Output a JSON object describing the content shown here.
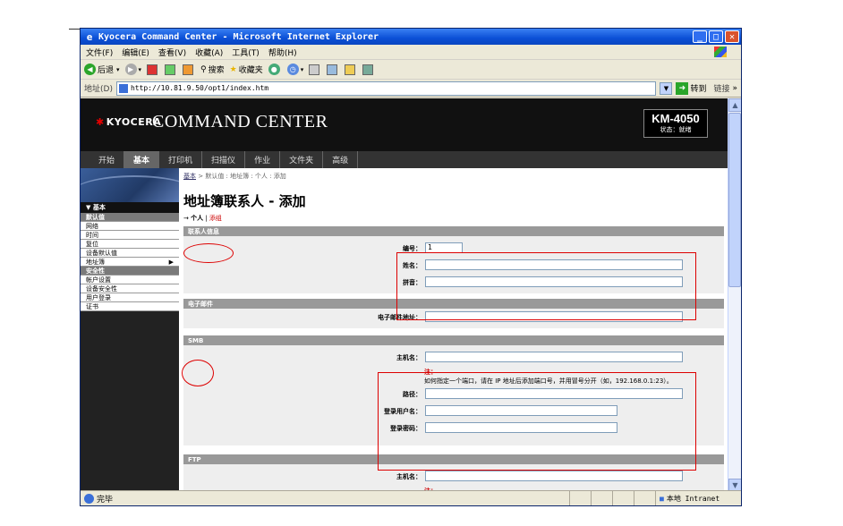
{
  "window": {
    "title": "Kyocera Command Center - Microsoft Internet Explorer",
    "minimize": "_",
    "maximize": "□",
    "close": "✕"
  },
  "menu": [
    "文件(F)",
    "编辑(E)",
    "查看(V)",
    "收藏(A)",
    "工具(T)",
    "帮助(H)"
  ],
  "toolbar": {
    "back": "后退",
    "search": "搜索",
    "favorites": "收藏夹"
  },
  "address": {
    "label": "地址(D)",
    "url": "http://10.81.9.50/opt1/index.htm",
    "go": "转到",
    "links": "链接"
  },
  "header": {
    "brand": "KYOCERA",
    "app_title": "COMMAND CENTER",
    "model": "KM-4050",
    "status": "状态：就绪"
  },
  "nav": {
    "tabs": [
      "开始",
      "基本",
      "打印机",
      "扫描仪",
      "作业",
      "文件夹",
      "高级"
    ],
    "active_index": 1
  },
  "sidebar": {
    "group1_head": "▼ 基本",
    "items": [
      {
        "label": "默认值",
        "selected": true
      },
      {
        "label": "网络",
        "selected": false
      },
      {
        "label": "时间",
        "selected": false
      },
      {
        "label": "复位",
        "selected": false
      },
      {
        "label": "设备默认值",
        "selected": false
      },
      {
        "label": "地址簿",
        "selected": false,
        "chevron": "▶"
      },
      {
        "label": "安全性",
        "selected": true
      },
      {
        "label": "帐户设置",
        "selected": false
      },
      {
        "label": "设备安全性",
        "selected": false
      },
      {
        "label": "用户登录",
        "selected": false
      },
      {
        "label": "证书",
        "selected": false
      }
    ]
  },
  "content": {
    "breadcrumb_link": "基本",
    "breadcrumb_rest": " > 默认值 : 地址簿 : 个人 : 添加",
    "page_title": "地址簿联系人 - 添加",
    "subnav_prefix": "→ ",
    "subnav_current": "个人",
    "subnav_sep": " | ",
    "subnav_link": "添组",
    "sections": {
      "contact": {
        "title": "联系人信息",
        "number_label": "编号：",
        "number_value": "1",
        "name_label": "姓名：",
        "furigana_label": "拼音："
      },
      "email": {
        "title": "电子邮件",
        "address_label": "电子邮件地址："
      },
      "smb": {
        "title": "SMB",
        "host_label": "主机名：",
        "note_head": "注：",
        "note_text": "如何指定一个端口，请在 IP 地址后添加端口号，并用冒号分开（如，192.168.0.1:23）。",
        "path_label": "路径：",
        "user_label": "登录用户名：",
        "password_label": "登录密码："
      },
      "ftp": {
        "title": "FTP",
        "host_label": "主机名：",
        "note_head": "注："
      }
    }
  },
  "status": {
    "done": "完毕",
    "zone": "本地 Intranet"
  }
}
